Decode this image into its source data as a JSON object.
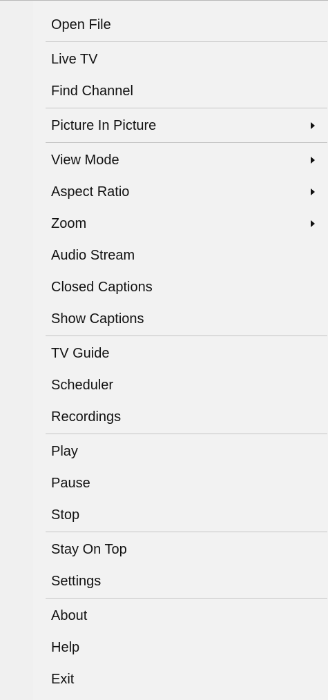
{
  "menu": {
    "groups": [
      {
        "items": [
          {
            "label": "Open File",
            "submenu": false
          }
        ]
      },
      {
        "items": [
          {
            "label": "Live TV",
            "submenu": false
          },
          {
            "label": "Find Channel",
            "submenu": false
          }
        ]
      },
      {
        "items": [
          {
            "label": "Picture In Picture",
            "submenu": true
          }
        ]
      },
      {
        "items": [
          {
            "label": "View Mode",
            "submenu": true
          },
          {
            "label": "Aspect Ratio",
            "submenu": true
          },
          {
            "label": "Zoom",
            "submenu": true
          },
          {
            "label": "Audio Stream",
            "submenu": false
          },
          {
            "label": "Closed Captions",
            "submenu": false
          },
          {
            "label": "Show Captions",
            "submenu": false
          }
        ]
      },
      {
        "items": [
          {
            "label": "TV Guide",
            "submenu": false
          },
          {
            "label": "Scheduler",
            "submenu": false
          },
          {
            "label": "Recordings",
            "submenu": false
          }
        ]
      },
      {
        "items": [
          {
            "label": "Play",
            "submenu": false
          },
          {
            "label": "Pause",
            "submenu": false
          },
          {
            "label": "Stop",
            "submenu": false
          }
        ]
      },
      {
        "items": [
          {
            "label": "Stay On Top",
            "submenu": false
          },
          {
            "label": "Settings",
            "submenu": false
          }
        ]
      },
      {
        "items": [
          {
            "label": "About",
            "submenu": false
          },
          {
            "label": "Help",
            "submenu": false
          },
          {
            "label": "Exit",
            "submenu": false
          }
        ]
      }
    ],
    "submenu_icon": "chevron-right-icon"
  }
}
